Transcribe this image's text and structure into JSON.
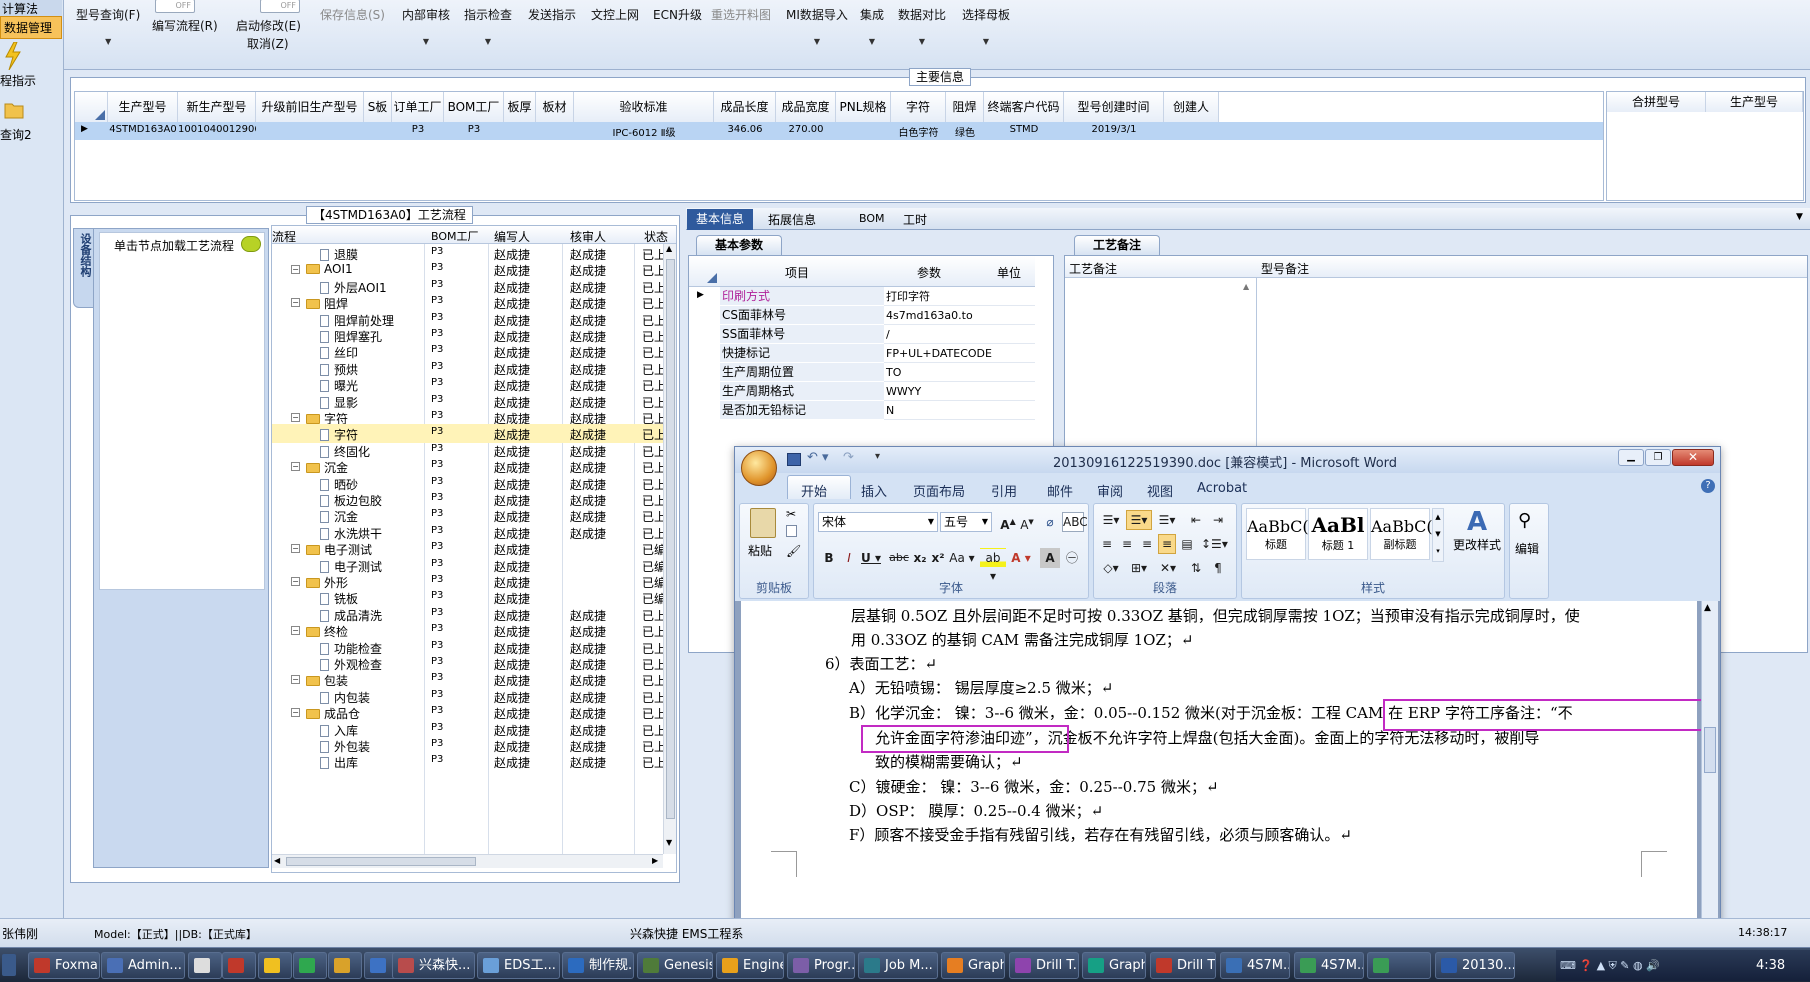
{
  "left_strip": {
    "top_label": "计算法",
    "active_item": "数据管理",
    "item2": "程指示",
    "item3": "查询2"
  },
  "toolbar": {
    "items": [
      {
        "label": "型号查询(F)",
        "disabled": false,
        "has_arrow": true
      },
      {
        "label": "编写流程(R)",
        "disabled": false,
        "has_arrow": false
      },
      {
        "label": "启动修改(E)",
        "disabled": false,
        "has_arrow": false
      },
      {
        "label": "取消(Z)",
        "disabled": false,
        "has_arrow": false
      },
      {
        "label": "保存信息(S)",
        "disabled": true,
        "has_arrow": false
      },
      {
        "label": "内部审核",
        "disabled": false,
        "has_arrow": true
      },
      {
        "label": "指示检查",
        "disabled": false,
        "has_arrow": true
      },
      {
        "label": "发送指示",
        "disabled": false,
        "has_arrow": false
      },
      {
        "label": "文控上网",
        "disabled": false,
        "has_arrow": false
      },
      {
        "label": "ECN升级",
        "disabled": false,
        "has_arrow": false
      },
      {
        "label": "重选开料图",
        "disabled": true,
        "has_arrow": false
      },
      {
        "label": "MI数据导入",
        "disabled": false,
        "has_arrow": true
      },
      {
        "label": "集成",
        "disabled": false,
        "has_arrow": true
      },
      {
        "label": "数据对比",
        "disabled": false,
        "has_arrow": true
      },
      {
        "label": "选择母板",
        "disabled": false,
        "has_arrow": true
      }
    ],
    "toggle1": "OFF",
    "toggle2": "OFF"
  },
  "main_info": {
    "legend": "主要信息",
    "columns": [
      "生产型号",
      "新生产型号",
      "升级前旧生产型号",
      "S板",
      "订单工厂",
      "BOM工厂",
      "板厚",
      "板材",
      "验收标准",
      "成品长度",
      "成品宽度",
      "PNL规格",
      "字符",
      "阻焊",
      "终端客户代码",
      "型号创建时间",
      "创建人"
    ],
    "row": [
      "4STMD163A0",
      "10010400129063",
      "",
      "",
      "P3",
      "P3",
      "",
      "",
      "IPC-6012 Ⅱ级",
      "346.06",
      "270.00",
      "",
      "白色字符",
      "绿色",
      "STMD",
      "2019/3/1",
      ""
    ],
    "side_columns": [
      "合拼型号",
      "生产型号"
    ]
  },
  "process_flow": {
    "legend": "【4STMD163A0】工艺流程",
    "vertical_tab": "设备结构",
    "hint": "单击节点加载工艺流程",
    "columns": [
      "流程",
      "BOM工厂",
      "编写人",
      "核审人",
      "状态"
    ],
    "rows": [
      {
        "name": "退膜",
        "level": 1,
        "folder": false,
        "bom": "P3",
        "writer": "赵成捷",
        "reviewer": "赵成捷",
        "status": "已上区"
      },
      {
        "name": "AOI1",
        "level": 0,
        "folder": true,
        "bom": "P3",
        "writer": "赵成捷",
        "reviewer": "赵成捷",
        "status": "已上区"
      },
      {
        "name": "外层AOI1",
        "level": 1,
        "folder": false,
        "bom": "P3",
        "writer": "赵成捷",
        "reviewer": "赵成捷",
        "status": "已上区"
      },
      {
        "name": "阻焊",
        "level": 0,
        "folder": true,
        "bom": "P3",
        "writer": "赵成捷",
        "reviewer": "赵成捷",
        "status": "已上区"
      },
      {
        "name": "阻焊前处理",
        "level": 1,
        "folder": false,
        "bom": "P3",
        "writer": "赵成捷",
        "reviewer": "赵成捷",
        "status": "已上区"
      },
      {
        "name": "阻焊塞孔",
        "level": 1,
        "folder": false,
        "bom": "P3",
        "writer": "赵成捷",
        "reviewer": "赵成捷",
        "status": "已上区"
      },
      {
        "name": "丝印",
        "level": 1,
        "folder": false,
        "bom": "P3",
        "writer": "赵成捷",
        "reviewer": "赵成捷",
        "status": "已上区"
      },
      {
        "name": "预烘",
        "level": 1,
        "folder": false,
        "bom": "P3",
        "writer": "赵成捷",
        "reviewer": "赵成捷",
        "status": "已上区"
      },
      {
        "name": "曝光",
        "level": 1,
        "folder": false,
        "bom": "P3",
        "writer": "赵成捷",
        "reviewer": "赵成捷",
        "status": "已上区"
      },
      {
        "name": "显影",
        "level": 1,
        "folder": false,
        "bom": "P3",
        "writer": "赵成捷",
        "reviewer": "赵成捷",
        "status": "已上区"
      },
      {
        "name": "字符",
        "level": 0,
        "folder": true,
        "bom": "P3",
        "writer": "赵成捷",
        "reviewer": "赵成捷",
        "status": "已上区"
      },
      {
        "name": "字符",
        "level": 1,
        "folder": false,
        "bom": "P3",
        "writer": "赵成捷",
        "reviewer": "赵成捷",
        "status": "已上区",
        "selected": true
      },
      {
        "name": "终固化",
        "level": 1,
        "folder": false,
        "bom": "P3",
        "writer": "赵成捷",
        "reviewer": "赵成捷",
        "status": "已上区"
      },
      {
        "name": "沉金",
        "level": 0,
        "folder": true,
        "bom": "P3",
        "writer": "赵成捷",
        "reviewer": "赵成捷",
        "status": "已上区"
      },
      {
        "name": "晒砂",
        "level": 1,
        "folder": false,
        "bom": "P3",
        "writer": "赵成捷",
        "reviewer": "赵成捷",
        "status": "已上区"
      },
      {
        "name": "板边包胶",
        "level": 1,
        "folder": false,
        "bom": "P3",
        "writer": "赵成捷",
        "reviewer": "赵成捷",
        "status": "已上区"
      },
      {
        "name": "沉金",
        "level": 1,
        "folder": false,
        "bom": "P3",
        "writer": "赵成捷",
        "reviewer": "赵成捷",
        "status": "已上区"
      },
      {
        "name": "水洗烘干",
        "level": 1,
        "folder": false,
        "bom": "P3",
        "writer": "赵成捷",
        "reviewer": "赵成捷",
        "status": "已上区"
      },
      {
        "name": "电子测试",
        "level": 0,
        "folder": true,
        "bom": "P3",
        "writer": "赵成捷",
        "reviewer": "",
        "status": "已编写"
      },
      {
        "name": "电子测试",
        "level": 1,
        "folder": false,
        "bom": "P3",
        "writer": "赵成捷",
        "reviewer": "",
        "status": "已编写"
      },
      {
        "name": "外形",
        "level": 0,
        "folder": true,
        "bom": "P3",
        "writer": "赵成捷",
        "reviewer": "",
        "status": "已编写"
      },
      {
        "name": "铣板",
        "level": 1,
        "folder": false,
        "bom": "P3",
        "writer": "赵成捷",
        "reviewer": "",
        "status": "已编写"
      },
      {
        "name": "成品清洗",
        "level": 1,
        "folder": false,
        "bom": "P3",
        "writer": "赵成捷",
        "reviewer": "赵成捷",
        "status": "已上区"
      },
      {
        "name": "终检",
        "level": 0,
        "folder": true,
        "bom": "P3",
        "writer": "赵成捷",
        "reviewer": "赵成捷",
        "status": "已上区"
      },
      {
        "name": "功能检查",
        "level": 1,
        "folder": false,
        "bom": "P3",
        "writer": "赵成捷",
        "reviewer": "赵成捷",
        "status": "已上区"
      },
      {
        "name": "外观检查",
        "level": 1,
        "folder": false,
        "bom": "P3",
        "writer": "赵成捷",
        "reviewer": "赵成捷",
        "status": "已上区"
      },
      {
        "name": "包装",
        "level": 0,
        "folder": true,
        "bom": "P3",
        "writer": "赵成捷",
        "reviewer": "赵成捷",
        "status": "已上区"
      },
      {
        "name": "内包装",
        "level": 1,
        "folder": false,
        "bom": "P3",
        "writer": "赵成捷",
        "reviewer": "赵成捷",
        "status": "已上区"
      },
      {
        "name": "成品仓",
        "level": 0,
        "folder": true,
        "bom": "P3",
        "writer": "赵成捷",
        "reviewer": "赵成捷",
        "status": "已上区"
      },
      {
        "name": "入库",
        "level": 1,
        "folder": false,
        "bom": "P3",
        "writer": "赵成捷",
        "reviewer": "赵成捷",
        "status": "已上区"
      },
      {
        "name": "外包装",
        "level": 1,
        "folder": false,
        "bom": "P3",
        "writer": "赵成捷",
        "reviewer": "赵成捷",
        "status": "已上区"
      },
      {
        "name": "出库",
        "level": 1,
        "folder": false,
        "bom": "P3",
        "writer": "赵成捷",
        "reviewer": "赵成捷",
        "status": "已上区"
      }
    ]
  },
  "detail_tabs": [
    "基本信息",
    "拓展信息",
    "BOM",
    "工时"
  ],
  "basic_params": {
    "tab": "基本参数",
    "columns": [
      "项目",
      "参数",
      "单位"
    ],
    "rows": [
      {
        "item": "印刷方式",
        "value": "打印字符",
        "unit": "",
        "highlight": true
      },
      {
        "item": "CS面菲林号",
        "value": "4s7md163a0.to",
        "unit": ""
      },
      {
        "item": "SS面菲林号",
        "value": "/",
        "unit": ""
      },
      {
        "item": "快捷标记",
        "value": "FP+UL+DATECODE",
        "unit": ""
      },
      {
        "item": "生产周期位置",
        "value": "TO",
        "unit": ""
      },
      {
        "item": "生产周期格式",
        "value": "WWYY",
        "unit": ""
      },
      {
        "item": "是否加无铅标记",
        "value": "N",
        "unit": ""
      }
    ]
  },
  "process_notes": {
    "tab": "工艺备注",
    "col1": "工艺备注",
    "col2": "型号备注"
  },
  "word": {
    "title": "20130916122519390.doc [兼容模式] - Microsoft Word",
    "tabs": [
      "开始",
      "插入",
      "页面布局",
      "引用",
      "邮件",
      "审阅",
      "视图",
      "Acrobat"
    ],
    "font_name": "宋体",
    "font_size": "五号",
    "groups": {
      "clipboard": "剪贴板",
      "font": "字体",
      "paragraph": "段落",
      "styles": "样式",
      "paste": "粘贴",
      "change_styles": "更改样式",
      "edit": "编辑"
    },
    "styles": [
      {
        "sample": "AaBbC(",
        "name": "标题"
      },
      {
        "sample": "AaBl",
        "name": "标题 1"
      },
      {
        "sample": "AaBbC(",
        "name": "副标题"
      }
    ],
    "lines": [
      "层基铜 0.5OZ 且外层间距不足时可按 0.33OZ 基铜，但完成铜厚需按 1OZ；当预审没有指示完成铜厚时，使",
      "用 0.33OZ 的基铜 CAM 需备注完成铜厚 1OZ；↵",
      "6）表面工艺：↵",
      "A）无铅喷锡：  锡层厚度≥2.5 微米；↵",
      "B）化学沉金：  镍：3--6 微米，金：0.05--0.152 微米(对于沉金板：工程 CAM 在 ERP 字符工序备注：“不",
      "允许金面字符渗油印迹”，沉金板不允许字符上焊盘(包括大金面)。金面上的字符无法移动时，被削导",
      "致的模糊需要确认；↵",
      "C）镀硬金：    镍：3--6 微米，金：0.25--0.75 微米；↵",
      "D）OSP：       膜厚：0.25--0.4 微米；↵",
      "F）顾客不接受金手指有残留引线，若存在有残留引线，必须与顾客确认。↵"
    ]
  },
  "status_bar": {
    "user": "张伟刚",
    "model": "Model:【正式】||DB:【正式库】",
    "company": "兴森快捷  EMS工程系",
    "time": "14:38:17"
  },
  "taskbar": {
    "tasks": [
      "Foxmail",
      "Admin...",
      "兴森快...",
      "EDS工...",
      "制作规...",
      "Genesis",
      "Engine...",
      "Progr...",
      "Job M...",
      "Graph...",
      "Drill T...",
      "Graphi...",
      "Drill T...",
      "4S7M...",
      "4S7M...",
      "20130..."
    ],
    "clock": "4:38"
  }
}
